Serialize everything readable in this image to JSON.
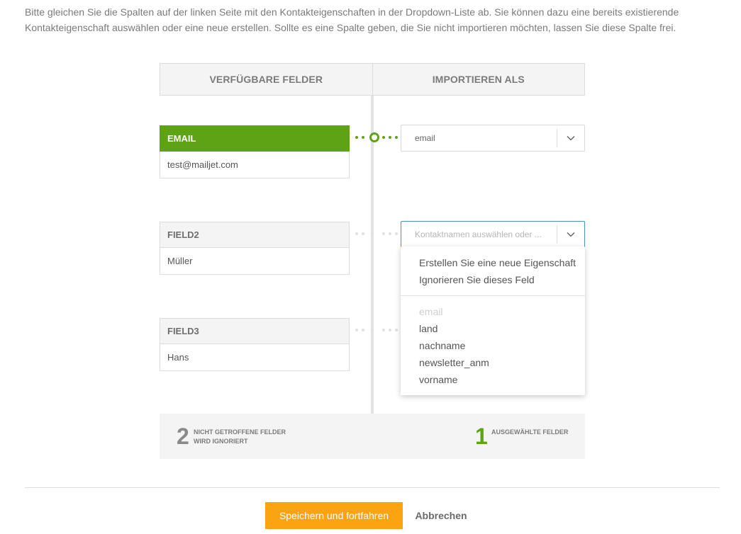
{
  "intro_text": "Bitte gleichen Sie die Spalten auf der linken Seite mit den Kontakteigenschaften in der Dropdown-Liste ab. Sie können dazu eine bereits existierende Kontakteigenschaft auswählen oder eine neue erstellen. Sollte es eine Spalte geben, die Sie nicht importieren möchten, lassen Sie diese Spalte frei.",
  "columns": {
    "available": "VERFÜGBARE FELDER",
    "import_as": "IMPORTIEREN ALS"
  },
  "fields": [
    {
      "name": "EMAIL",
      "value": "test@mailjet.com",
      "mapped": "email"
    },
    {
      "name": "FIELD2",
      "value": "Müller",
      "placeholder": "Kontaktnamen auswählen oder ..."
    },
    {
      "name": "FIELD3",
      "value": "Hans"
    }
  ],
  "dropdown": {
    "actions": [
      "Erstellen Sie eine neue Eigenschaft",
      "Ignorieren Sie dieses Feld"
    ],
    "options": [
      "email",
      "land",
      "nachname",
      "newsletter_anm",
      "vorname"
    ],
    "disabled_option": "email"
  },
  "summary": {
    "unmatched_count": "2",
    "unmatched_label_1": "NICHT GETROFFENE FELDER",
    "unmatched_label_2": "WIRD IGNORIERT",
    "selected_count": "1",
    "selected_label": "AUSGEWÄHLTE FELDER"
  },
  "buttons": {
    "save": "Speichern und fortfahren",
    "cancel": "Abbrechen"
  },
  "colors": {
    "accent_green": "#5ea315",
    "save_orange": "#fca312",
    "focus_blue": "#4a8fd0"
  },
  "icons": {
    "select_toggle": "chevron-down-icon"
  }
}
